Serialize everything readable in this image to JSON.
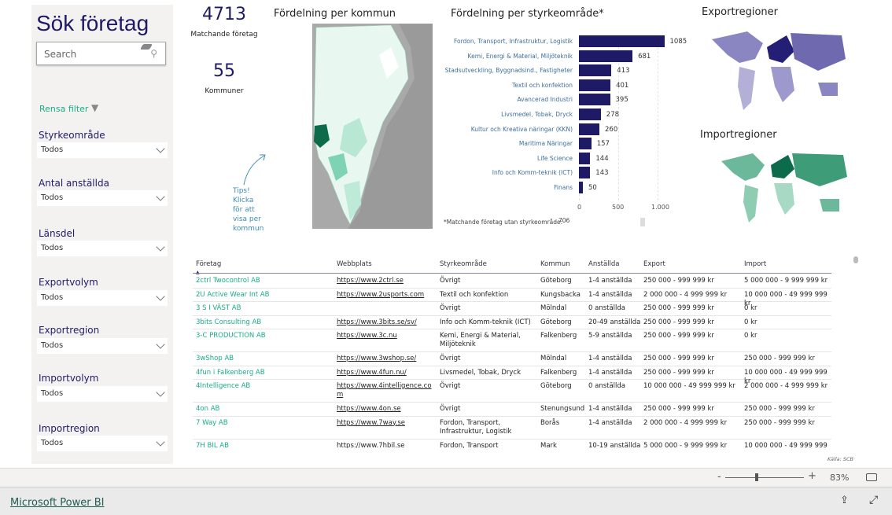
{
  "colors": {
    "accent": "#1f1a66",
    "link_green": "#1aab8a",
    "map_dark": "#0b6b4a",
    "map_light": "#e6f6ef"
  },
  "sidebar": {
    "title": "Sök företag",
    "search_placeholder": "Search",
    "clear_filter": "Rensa filter",
    "filters": [
      {
        "label": "Styrkeområde",
        "value": "Todos"
      },
      {
        "label": "Antal anställda",
        "value": "Todos"
      },
      {
        "label": "Länsdel",
        "value": "Todos"
      },
      {
        "label": "Exportvolym",
        "value": "Todos"
      },
      {
        "label": "Exportregion",
        "value": "Todos"
      },
      {
        "label": "Importvolym",
        "value": "Todos"
      },
      {
        "label": "Importregion",
        "value": "Todos"
      }
    ]
  },
  "kpis": {
    "companies": "4713",
    "companies_label": "Matchande företag",
    "municipalities": "55",
    "municipalities_label": "Kommuner"
  },
  "tips": [
    "Tips!",
    "Klicka",
    "för att",
    "visa per",
    "kommun"
  ],
  "map_title": "Fördelning per kommun",
  "export_title": "Exportregioner",
  "import_title": "Importregioner",
  "chart_data": {
    "type": "bar",
    "orientation": "horizontal",
    "title": "Fördelning per styrkeområde*",
    "categories": [
      "Fordon, Transport, Infrastruktur, Logistik",
      "Kemi, Energi & Material, Miljöteknik",
      "Stadsutveckling, Byggnadsind., Fastigheter",
      "Textil och konfektion",
      "Avancerad Industri",
      "Livsmedel, Tobak, Dryck",
      "Kultur och Kreativa näringar (KKN)",
      "Maritima Näringar",
      "Life Science",
      "Info och Komm-teknik (ICT)",
      "Finans"
    ],
    "values": [
      1085,
      681,
      413,
      401,
      395,
      278,
      260,
      157,
      144,
      143,
      50
    ],
    "xticks": [
      "0",
      "500",
      "1.000"
    ],
    "xlim": [
      0,
      1100
    ],
    "grid": true,
    "color": "#1f1a66"
  },
  "footnote": {
    "label": "*Matchande företag utan styrkeområde:",
    "value": "706"
  },
  "table": {
    "headers": [
      "Företag",
      "Webbplats",
      "Styrkeområde",
      "Kommun",
      "Anställda",
      "Export",
      "Import"
    ],
    "rows": [
      [
        "2ctrl Twocontrol AB",
        "https://www.2ctrl.se",
        "Övrigt",
        "Göteborg",
        "1-4 anställda",
        "250 000 - 999 999 kr",
        "5 000 000 - 9 999 999 kr"
      ],
      [
        "2U Active Wear Int AB",
        "https://www.2usports.com",
        "Textil och konfektion",
        "Kungsbacka",
        "1-4 anställda",
        "2 000 000 - 4 999 999 kr",
        "10 000 000 - 49 999 999 kr"
      ],
      [
        "3 S I VÄST AB",
        "",
        "Övrigt",
        "Mölndal",
        "0 anställda",
        "250 000 - 999 999 kr",
        "0 kr"
      ],
      [
        "3bits Consulting AB",
        "https://www.3bits.se/sv/",
        "Info och Komm-teknik (ICT)",
        "Göteborg",
        "20-49 anställda",
        "250 000 - 999 999 kr",
        "0 kr"
      ],
      [
        "3-C PRODUCTION AB",
        "https://www.3c.nu",
        "Kemi, Energi & Material, Miljöteknik",
        "Falkenberg",
        "5-9 anställda",
        "250 000 - 999 999 kr",
        "0 kr"
      ],
      [
        "3wShop AB",
        "https://www.3wshop.se/",
        "Övrigt",
        "Mölndal",
        "1-4 anställda",
        "250 000 - 999 999 kr",
        "250 000 - 999 999 kr"
      ],
      [
        "4fun i Falkenberg AB",
        "https://www.4fun.nu/",
        "Livsmedel, Tobak, Dryck",
        "Falkenberg",
        "1-4 anställda",
        "250 000 - 999 999 kr",
        "10 000 000 - 49 999 999 kr"
      ],
      [
        "4Intelligence AB",
        "https://www.4intelligence.com",
        "Övrigt",
        "Göteborg",
        "0 anställda",
        "10 000 000 - 49 999 999 kr",
        "2 000 000 - 4 999 999 kr"
      ],
      [
        "4on AB",
        "https://www.4on.se",
        "Övrigt",
        "Stenungsund",
        "1-4 anställda",
        "250 000 - 999 999 kr",
        "250 000 - 999 999 kr"
      ],
      [
        "7 Way AB",
        "https://www.7way.se",
        "Fordon, Transport, Infrastruktur, Logistik",
        "Borås",
        "1-4 anställda",
        "2 000 000 - 4 999 999 kr",
        "250 000 - 999 999 kr"
      ],
      [
        "7H BIL AB",
        "https://www.7hbil.se",
        "Fordon, Transport",
        "Mark",
        "10-19 anställda",
        "5 000 000 - 9 999 999 kr",
        "10 000 000 - 49 999 999 kr"
      ]
    ]
  },
  "source": "Källa: SCB",
  "zoom": {
    "minus": "-",
    "plus": "+",
    "level": "83%"
  },
  "brand_link": "Microsoft Power BI"
}
